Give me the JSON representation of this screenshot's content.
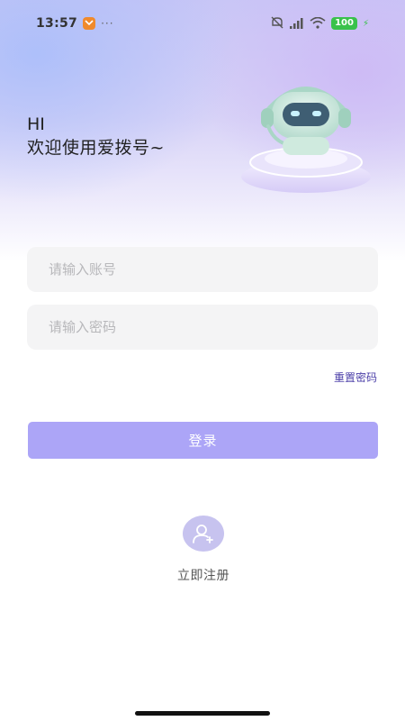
{
  "status_bar": {
    "time": "13:57",
    "more_indicator": "···",
    "battery_level": "100",
    "icons": [
      "mute-icon",
      "signal-icon",
      "wifi-icon",
      "battery-icon",
      "charging-icon"
    ]
  },
  "greeting": {
    "hi": "HI",
    "welcome": "欢迎使用爱拨号~"
  },
  "form": {
    "account_placeholder": "请输入账号",
    "password_placeholder": "请输入密码",
    "reset_password_label": "重置密码",
    "login_label": "登录"
  },
  "register": {
    "label": "立即注册"
  },
  "colors": {
    "accent": "#aca5f7",
    "link": "#4b3fa8",
    "input_bg": "#f4f4f5",
    "battery": "#39c24b"
  }
}
